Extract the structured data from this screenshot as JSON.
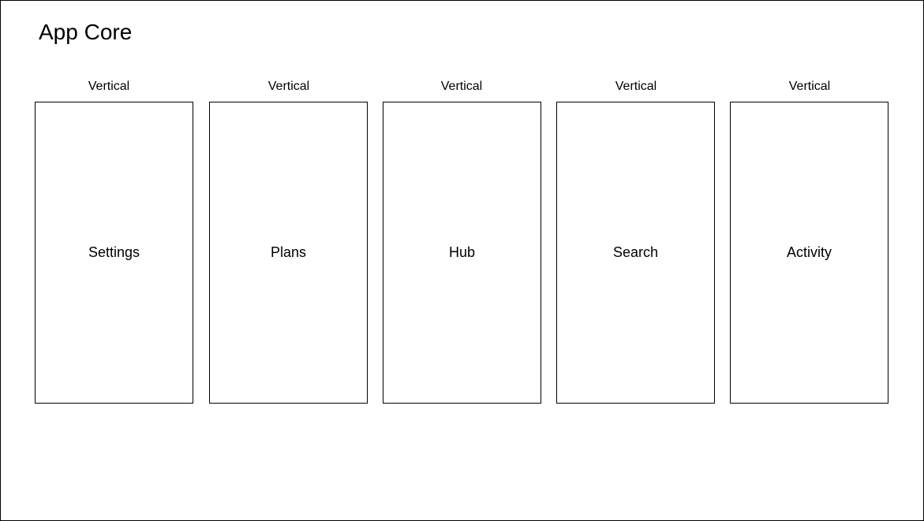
{
  "diagram": {
    "title": "App Core",
    "columns": [
      {
        "orientation": "Vertical",
        "name": "Settings"
      },
      {
        "orientation": "Vertical",
        "name": "Plans"
      },
      {
        "orientation": "Vertical",
        "name": "Hub"
      },
      {
        "orientation": "Vertical",
        "name": "Search"
      },
      {
        "orientation": "Vertical",
        "name": "Activity"
      }
    ]
  }
}
